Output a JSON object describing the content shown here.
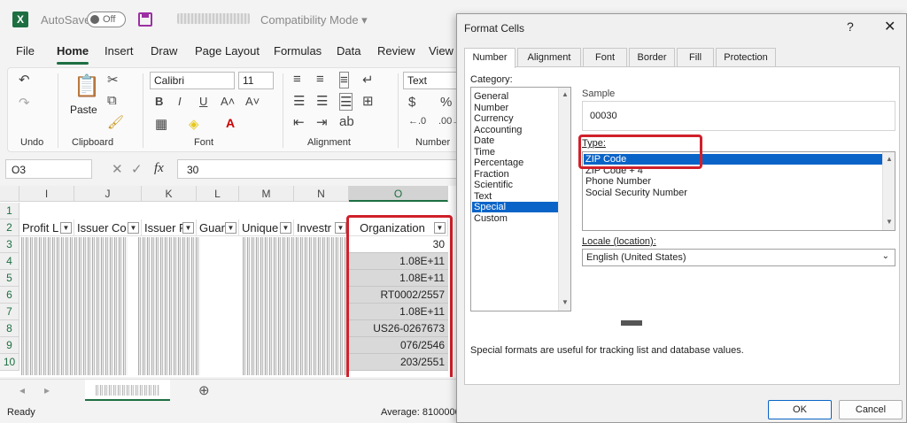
{
  "app": {
    "autosave_label": "AutoSave",
    "autosave_state": "Off",
    "compat_mode": "Compatibility Mode ▾"
  },
  "menu": [
    "File",
    "Home",
    "Insert",
    "Draw",
    "Page Layout",
    "Formulas",
    "Data",
    "Review",
    "View"
  ],
  "ribbon": {
    "undo_label": "Undo",
    "clipboard_label": "Clipboard",
    "paste_label": "Paste",
    "font_label": "Font",
    "font_name": "Calibri",
    "font_size": "11",
    "alignment_label": "Alignment",
    "number_label": "Number",
    "number_format": "Text"
  },
  "formula_bar": {
    "name_box": "O3",
    "fx": "fx",
    "value": "30"
  },
  "grid": {
    "columns": [
      "I",
      "J",
      "K",
      "L",
      "M",
      "N",
      "O"
    ],
    "rows": [
      "1",
      "2",
      "3",
      "4",
      "5",
      "6",
      "7",
      "8",
      "9",
      "10"
    ],
    "headers": [
      "Profit L",
      "Issuer Co",
      "Issuer F",
      "Guar",
      "Unique",
      "Investr",
      "Organization"
    ],
    "org_values": [
      "30",
      "1.08E+11",
      "1.08E+11",
      "RT0002/2557",
      "1.08E+11",
      "US26-0267673",
      "076/2546",
      "203/2551"
    ]
  },
  "status": {
    "ready": "Ready",
    "average": "Average: 8100000"
  },
  "dialog": {
    "title": "Format Cells",
    "help": "?",
    "close": "✕",
    "tabs": [
      "Number",
      "Alignment",
      "Font",
      "Border",
      "Fill",
      "Protection"
    ],
    "category_label": "Category:",
    "categories": [
      "General",
      "Number",
      "Currency",
      "Accounting",
      "Date",
      "Time",
      "Percentage",
      "Fraction",
      "Scientific",
      "Text",
      "Special",
      "Custom"
    ],
    "selected_category": "Special",
    "sample_label": "Sample",
    "sample_value": "00030",
    "type_label": "Type:",
    "types": [
      "ZIP Code",
      "ZIP Code + 4",
      "Phone Number",
      "Social Security Number"
    ],
    "selected_type": "ZIP Code",
    "locale_label": "Locale (location):",
    "locale_value": "English (United States)",
    "description": "Special formats are useful for tracking list and database values.",
    "ok_label": "OK",
    "cancel_label": "Cancel"
  },
  "colors": {
    "accent": "#1d6f42",
    "highlight": "#d0202a",
    "selection": "#0a64c8"
  }
}
